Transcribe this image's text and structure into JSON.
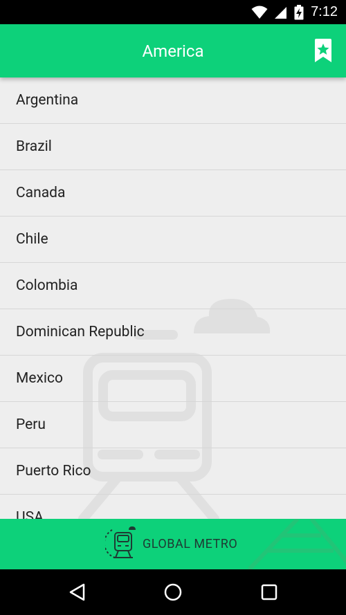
{
  "status_bar": {
    "time": "7:12"
  },
  "app_bar": {
    "title": "America"
  },
  "countries": [
    "Argentina",
    "Brazil",
    "Canada",
    "Chile",
    "Colombia",
    "Dominican Republic",
    "Mexico",
    "Peru",
    "Puerto Rico",
    "USA"
  ],
  "footer": {
    "brand": "GLOBAL METRO"
  },
  "colors": {
    "accent": "#0dd17a",
    "background": "#eeeeee",
    "divider": "#d6d6d6"
  }
}
